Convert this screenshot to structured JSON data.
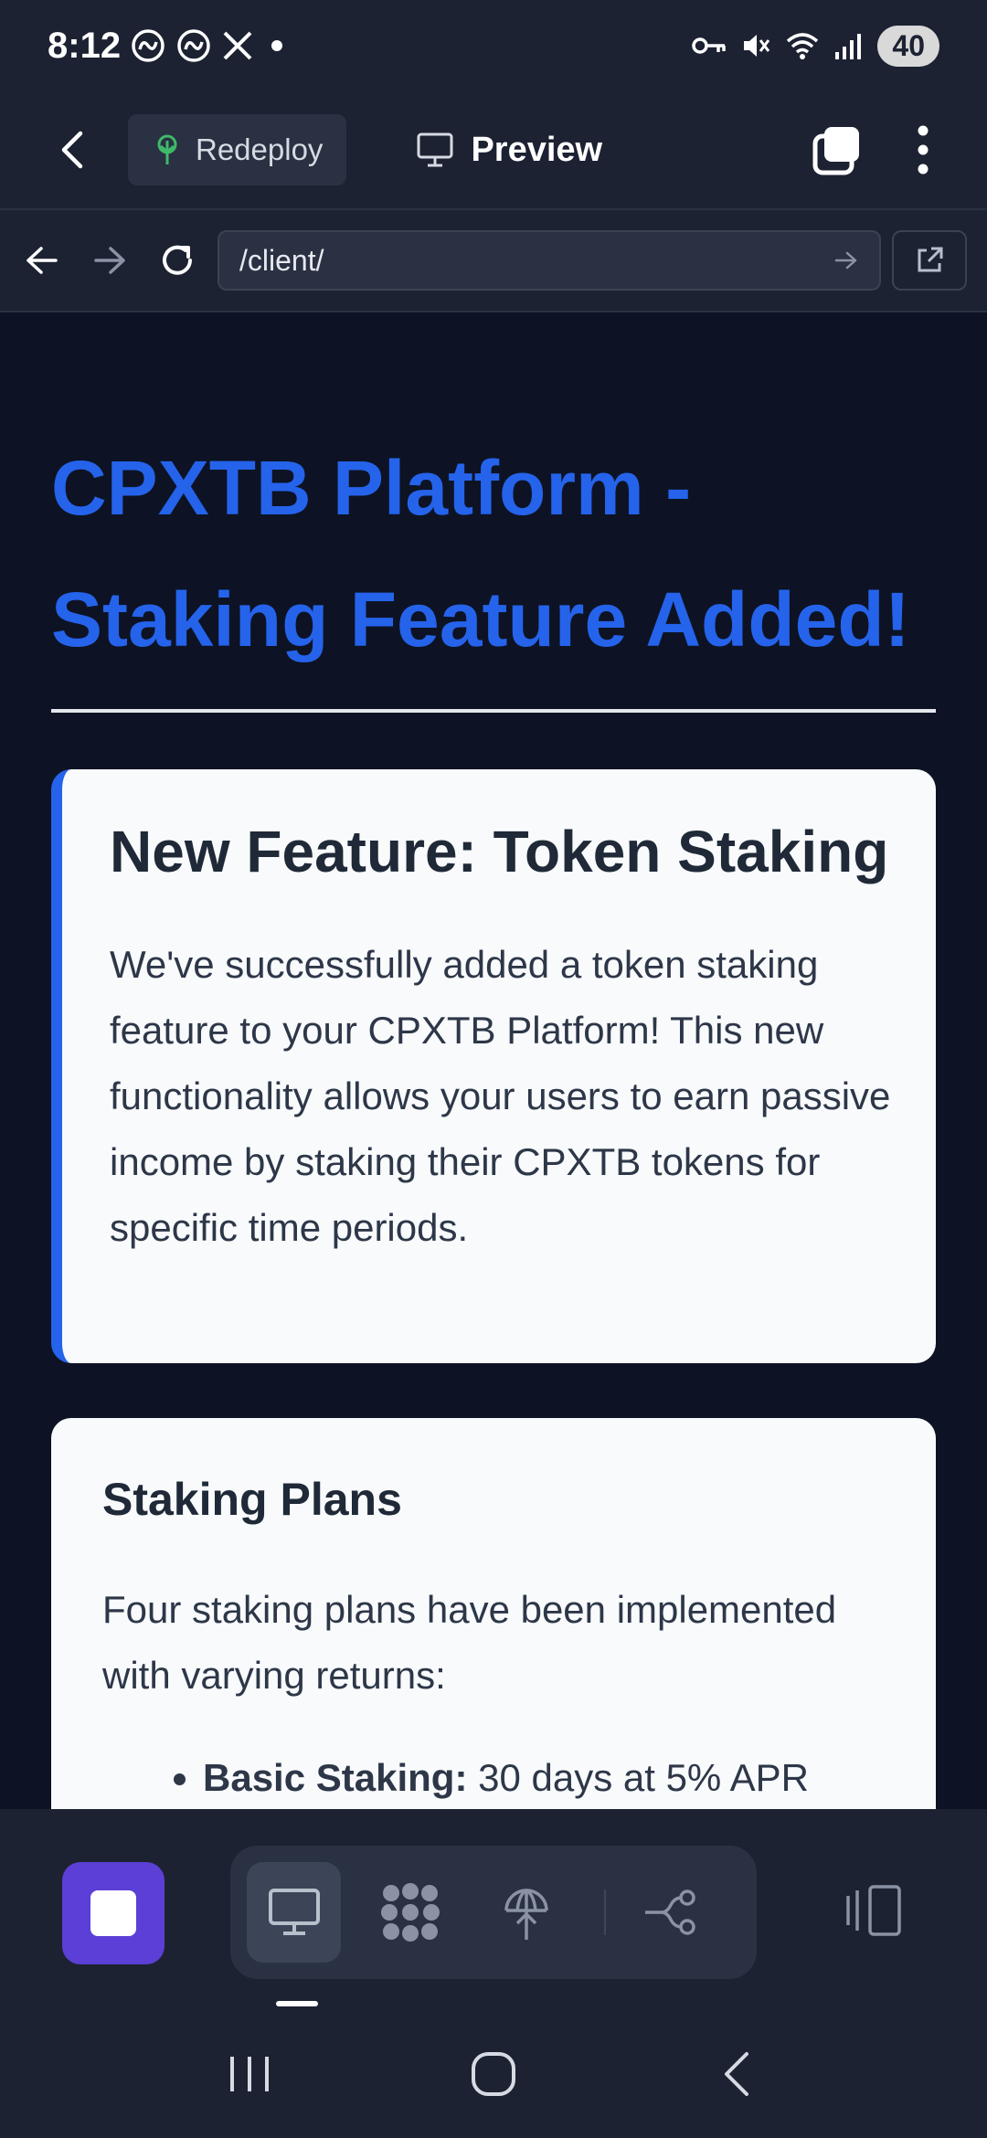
{
  "status_bar": {
    "time": "8:12",
    "battery": "40",
    "left_icons": [
      "threads-icon",
      "threads-icon",
      "x-icon",
      "dot-icon"
    ],
    "right_icons": [
      "key-icon",
      "mute-icon",
      "wifi-icon",
      "signal-icon"
    ]
  },
  "toolbar": {
    "redeploy_label": "Redeploy",
    "preview_label": "Preview"
  },
  "url_bar": {
    "url": "/client/"
  },
  "page": {
    "title": "CPXTB Platform - Staking Feature Added!",
    "card1": {
      "title": "New Feature: Token Staking",
      "body": "We've successfully added a token staking feature to your CPXTB Platform! This new functionality allows your users to earn passive income by staking their CPXTB tokens for specific time periods."
    },
    "card2": {
      "title": "Staking Plans",
      "body": "Four staking plans have been implemented with varying returns:",
      "plans": [
        {
          "name": "Basic Staking:",
          "detail": " 30 days at 5% APR"
        }
      ]
    }
  },
  "colors": {
    "accent_blue": "#2563eb",
    "stop_purple": "#5b3fd6",
    "chrome_bg": "#1c2232",
    "page_bg": "#0d1324"
  }
}
